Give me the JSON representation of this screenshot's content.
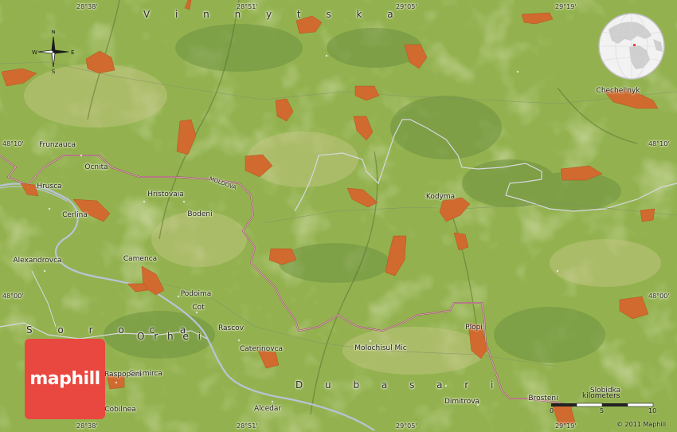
{
  "brand": {
    "logo_text": "maphill",
    "logo_color": "#e84840"
  },
  "compass": {
    "north": "N",
    "south": "S",
    "east": "E",
    "west": "W"
  },
  "regions": {
    "vinnytska": "V i n n y t s k a",
    "soroca": "S o r o c a",
    "orhei": "O r h e i",
    "dubasari": "D u b a s a r i"
  },
  "border_label": "MOLDOVA",
  "coordinates": {
    "top": [
      "28°38'",
      "28°51'",
      "29°05'",
      "29°19'"
    ],
    "bottom": [
      "28°38'",
      "28°51'",
      "29°05'",
      "29°19'"
    ],
    "left": [
      "48°10'",
      "48°00'"
    ],
    "right": [
      "48°10'",
      "48°00'"
    ]
  },
  "places": {
    "frunzauca": "Frunzauca",
    "ocnita": "Ocnita",
    "hrusca": "Hrusca",
    "hristovaia": "Hristovaia",
    "cerlina": "Cerlina",
    "bodeni": "Bodeni",
    "alexandrovca": "Alexandrovca",
    "camenca": "Camenca",
    "podoima": "Podoima",
    "cot": "Cot",
    "rascov": "Rascov",
    "caterinovca": "Caterinovca",
    "molochisul_mic": "Molochisul Mic",
    "plopi": "Plopi",
    "kodyma": "Kodyma",
    "chechelnyk": "Chechel'nyk",
    "cusmirca": "Cusmirca",
    "cobilnea": "Cobilnea",
    "alcedar": "Alcedar",
    "dimitrova": "Dimitrova",
    "brosteni": "Brosteni",
    "slobidka": "Slobidka",
    "raspopeni": "Raspopeni"
  },
  "scale": {
    "label": "kilometers",
    "start": "0",
    "mid": "5",
    "end": "10"
  },
  "copyright": "© 2011 Maphill",
  "colors": {
    "terrain": "#8fae4e",
    "urban": "#d06a2e",
    "border": "#a05a6a",
    "river": "#b8c4d8"
  }
}
